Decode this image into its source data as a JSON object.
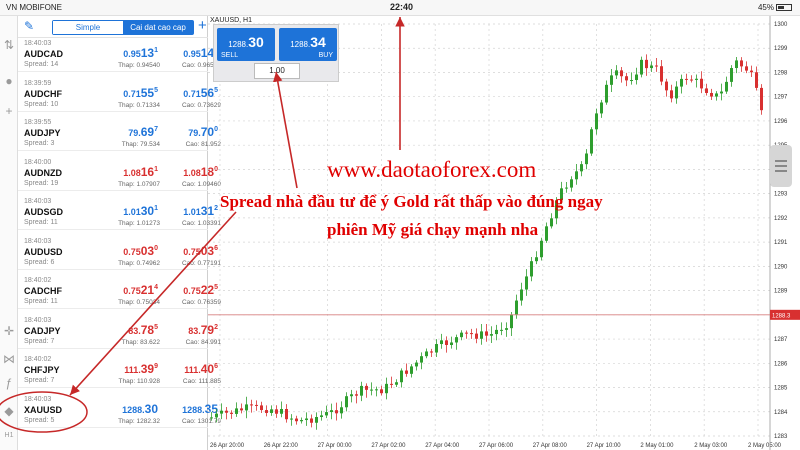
{
  "status_bar": {
    "carrier": "VN MOBIFONE",
    "time": "22:40",
    "battery": "45%"
  },
  "watchlist": {
    "tabs": [
      {
        "label": "Simple",
        "active": false
      },
      {
        "label": "Cai dat cao cap",
        "active": true
      }
    ],
    "rows": [
      {
        "time": "18:40:03",
        "symbol": "AUDCAD",
        "spread": "Spread: 14",
        "bid_main": "0.95",
        "bid_big": "13",
        "bid_sup": "1",
        "ask_main": "0.95",
        "ask_big": "14",
        "ask_sup": "5",
        "low": "Thap: 0.94540",
        "high": "Cao: 0.96554",
        "color": "up"
      },
      {
        "time": "18:39:59",
        "symbol": "AUDCHF",
        "spread": "Spread: 10",
        "bid_main": "0.71",
        "bid_big": "55",
        "bid_sup": "5",
        "ask_main": "0.71",
        "ask_big": "56",
        "ask_sup": "5",
        "low": "Thap: 0.71334",
        "high": "Cao: 0.73629",
        "color": "up"
      },
      {
        "time": "18:39:55",
        "symbol": "AUDJPY",
        "spread": "Spread: 3",
        "bid_main": "79.",
        "bid_big": "69",
        "bid_sup": "7",
        "ask_main": "79.",
        "ask_big": "70",
        "ask_sup": "0",
        "low": "Thap: 79.534",
        "high": "Cao: 81.952",
        "color": "up"
      },
      {
        "time": "18:40:00",
        "symbol": "AUDNZD",
        "spread": "Spread: 19",
        "bid_main": "1.08",
        "bid_big": "16",
        "bid_sup": "1",
        "ask_main": "1.08",
        "ask_big": "18",
        "ask_sup": "0",
        "low": "Thap: 1.07907",
        "high": "Cao: 1.09460",
        "color": "dn"
      },
      {
        "time": "18:40:03",
        "symbol": "AUDSGD",
        "spread": "Spread: 11",
        "bid_main": "1.01",
        "bid_big": "30",
        "bid_sup": "1",
        "ask_main": "1.01",
        "ask_big": "31",
        "ask_sup": "2",
        "low": "Thap: 1.01273",
        "high": "Cao: 1.03391",
        "color": "up"
      },
      {
        "time": "18:40:03",
        "symbol": "AUDUSD",
        "spread": "Spread: 6",
        "bid_main": "0.75",
        "bid_big": "03",
        "bid_sup": "0",
        "ask_main": "0.75",
        "ask_big": "03",
        "ask_sup": "6",
        "low": "Thap: 0.74962",
        "high": "Cao: 0.77191",
        "color": "dn"
      },
      {
        "time": "18:40:02",
        "symbol": "CADCHF",
        "spread": "Spread: 11",
        "bid_main": "0.75",
        "bid_big": "21",
        "bid_sup": "4",
        "ask_main": "0.75",
        "ask_big": "22",
        "ask_sup": "5",
        "low": "Thap: 0.75034",
        "high": "Cao: 0.76359",
        "color": "dn"
      },
      {
        "time": "18:40:03",
        "symbol": "CADJPY",
        "spread": "Spread: 7",
        "bid_main": "83.",
        "bid_big": "78",
        "bid_sup": "5",
        "ask_main": "83.",
        "ask_big": "79",
        "ask_sup": "2",
        "low": "Thap: 83.622",
        "high": "Cao: 84.991",
        "color": "dn"
      },
      {
        "time": "18:40:02",
        "symbol": "CHFJPY",
        "spread": "Spread: 7",
        "bid_main": "111.",
        "bid_big": "39",
        "bid_sup": "9",
        "ask_main": "111.",
        "ask_big": "40",
        "ask_sup": "6",
        "low": "Thap: 110.928",
        "high": "Cao: 111.885",
        "color": "dn"
      },
      {
        "time": "18:40:03",
        "symbol": "XAUUSD",
        "spread": "Spread: 5",
        "bid_main": "1288.",
        "bid_big": "30",
        "bid_sup": "",
        "ask_main": "1288.",
        "ask_big": "35",
        "ask_sup": "",
        "low": "Thap: 1282.32",
        "high": "Cao: 1301.79",
        "color": "up"
      }
    ]
  },
  "chart": {
    "title": "XAUUSD, H1",
    "sell_price_small": "1288.",
    "sell_price_big": "30",
    "sell_label": "SELL",
    "buy_price_small": "1288.",
    "buy_price_big": "34",
    "buy_label": "BUY",
    "lot_value": "1.00",
    "current_price_label": "1288.3",
    "y_axis_labels": [
      "1300",
      "1299",
      "1298",
      "1297",
      "1296",
      "1295",
      "1294",
      "1293",
      "1292",
      "1291",
      "1290",
      "1289",
      "1288",
      "1287",
      "1286",
      "1285",
      "1284",
      "1283"
    ],
    "x_axis_labels": [
      "26 Apr 20:00",
      "26 Apr 22:00",
      "27 Apr 00:00",
      "27 Apr 02:00",
      "27 Apr 04:00",
      "27 Apr 06:00",
      "27 Apr 08:00",
      "27 Apr 10:00",
      "2 May 01:00",
      "2 May 03:00",
      "2 May 05:00"
    ]
  },
  "annotations": {
    "website": "www.daotaoforex.com",
    "line1": "Spread nhà đầu tư để ý Gold rất thấp vào đúng ngay",
    "line2": "phiên Mỹ giá chạy mạnh nha"
  },
  "colors": {
    "accent": "#1e73d8",
    "bearish": "#d83030",
    "bullish": "#2e9e2e",
    "annotation": "#e00000"
  }
}
